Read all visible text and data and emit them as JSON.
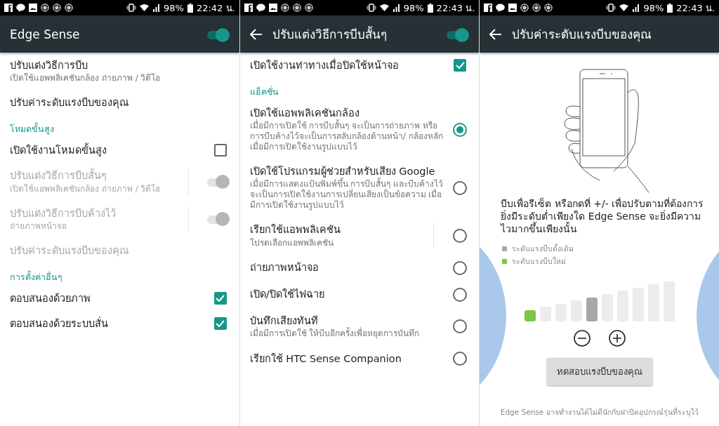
{
  "panels": [
    {
      "kind": "list",
      "status_bar": {
        "battery": "98%",
        "time": "22:42 น."
      },
      "app_bar": {
        "title": "Edge Sense",
        "back": false,
        "switch": {
          "on": true
        }
      },
      "items": [
        {
          "kind": "plain",
          "title": "ปรับแต่งวิธีการบีบ",
          "subtitle": "เปิดใช้แอพพลิเคชันกล้อง ถ่ายภาพ / วิดีโอ",
          "disabled": false
        },
        {
          "kind": "plain",
          "title": "ปรับค่าระดับแรงบีบของคุณ",
          "disabled": false
        },
        {
          "kind": "section",
          "title": "โหมดขั้นสูง"
        },
        {
          "kind": "checkbox",
          "title": "เปิดใช้งานโหมดขั้นสูง",
          "checked": false,
          "disabled": false
        },
        {
          "kind": "switch",
          "title": "ปรับแต่งวิธีการบีบสั้นๆ",
          "subtitle": "เปิดใช้แอพพลิเคชันกล้อง ถ่ายภาพ / วิดีโอ",
          "on": true,
          "disabled": true,
          "split": true
        },
        {
          "kind": "switch",
          "title": "ปรับแต่งวิธีการบีบค้างไว้",
          "subtitle": "ถ่ายภาพหน้าจอ",
          "on": true,
          "disabled": true,
          "split": true
        },
        {
          "kind": "plain",
          "title": "ปรับค่าระดับแรงบีบของคุณ",
          "disabled": true
        },
        {
          "kind": "section",
          "title": "การตั้งค่าอื่นๆ"
        },
        {
          "kind": "checkbox",
          "title": "ตอบสนองด้วยภาพ",
          "checked": true,
          "disabled": false
        },
        {
          "kind": "checkbox",
          "title": "ตอบสนองด้วยระบบสั่น",
          "checked": true,
          "disabled": false
        }
      ]
    },
    {
      "kind": "list",
      "status_bar": {
        "battery": "98%",
        "time": "22:43 น."
      },
      "app_bar": {
        "title": "ปรับแต่งวิธีการบีบสั้นๆ",
        "back": true,
        "switch": {
          "on": true
        }
      },
      "items": [
        {
          "kind": "checkbox",
          "title": "เปิดใช้งานท่าทางเมื่อปิดใช้หน้าจอ",
          "checked": true,
          "disabled": false
        },
        {
          "kind": "section",
          "title": "แอ็คชั่น"
        },
        {
          "kind": "radio",
          "title": "เปิดใช้แอพพลิเคชันกล้อง",
          "subtitle": "เมื่อมีการเปิดใช้ การบีบสั้นๆ จะเป็นการถ่ายภาพ หรือการบีบค้างไว้จะเป็นการสลับกล้องด้านหน้า/ กล้องหลัก เมื่อมีการเปิดใช้งานรูปแบบไว้",
          "selected": true,
          "disabled": false
        },
        {
          "kind": "radio",
          "title": "เปิดใช้โปรแกรมผู้ช่วยสำหรับเสียง Google",
          "subtitle": "เมื่อมีการแสดงแป้นพิมพ์ขึ้น การบีบสั้นๆ และบีบค้างไว้จะเป็นการเปิดใช้งานการเปลี่ยนเสียงเป็นข้อความ เมื่อมีการเปิดใช้งานรูปแบบไว้",
          "selected": false,
          "disabled": false
        },
        {
          "kind": "radio",
          "title": "เรียกใช้แอพพลิเคชัน",
          "subtitle": "โปรดเลือกแอพพลิเคชัน",
          "selected": false,
          "disabled": false,
          "split": true
        },
        {
          "kind": "radio",
          "title": "ถ่ายภาพหน้าจอ",
          "selected": false,
          "disabled": false
        },
        {
          "kind": "radio",
          "title": "เปิด/ปิดใช้ไฟฉาย",
          "selected": false,
          "disabled": false
        },
        {
          "kind": "radio",
          "title": "บันทึกเสียงทันที",
          "subtitle": "เมื่อมีการเปิดใช้ ให้บีบอีกครั้งเพื่อหยุดการบันทึก",
          "selected": false,
          "disabled": false
        },
        {
          "kind": "radio",
          "title": "เรียกใช้ HTC Sense Companion",
          "selected": false,
          "disabled": false
        }
      ]
    },
    {
      "kind": "calibration",
      "status_bar": {
        "battery": "98%",
        "time": "22:43 น."
      },
      "app_bar": {
        "title": "ปรับค่าระดับแรงบีบของคุณ",
        "back": true
      },
      "instructions": "บีบเพื่อรีเซ็ต หรือกดที่ +/- เพื่อปรับตามที่ต้องการ ยิ่งมีระดับต่ำเพียงใด Edge Sense จะยิ่งมีความไวมากขึ้นเพียงนั้น",
      "legend": [
        {
          "kind": "default",
          "label": "ระดับแรงบีบดั้งเดิม",
          "color": "#a8a8a8"
        },
        {
          "kind": "new",
          "label": "ระดับแรงบีบใหม่",
          "color": "#7cc843"
        }
      ],
      "bars": [
        {
          "kind": "new"
        },
        {
          "kind": "plain"
        },
        {
          "kind": "plain"
        },
        {
          "kind": "plain"
        },
        {
          "kind": "default"
        },
        {
          "kind": "plain"
        },
        {
          "kind": "plain"
        },
        {
          "kind": "plain"
        },
        {
          "kind": "plain"
        },
        {
          "kind": "plain"
        }
      ],
      "test_button": "ทดสอบแรงบีบของคุณ",
      "footnote": "Edge Sense อาจทำงานได้ไม่ดีนักกับฝาปิดอุปกรณ์รุ่นที่ระบุไว้"
    }
  ]
}
